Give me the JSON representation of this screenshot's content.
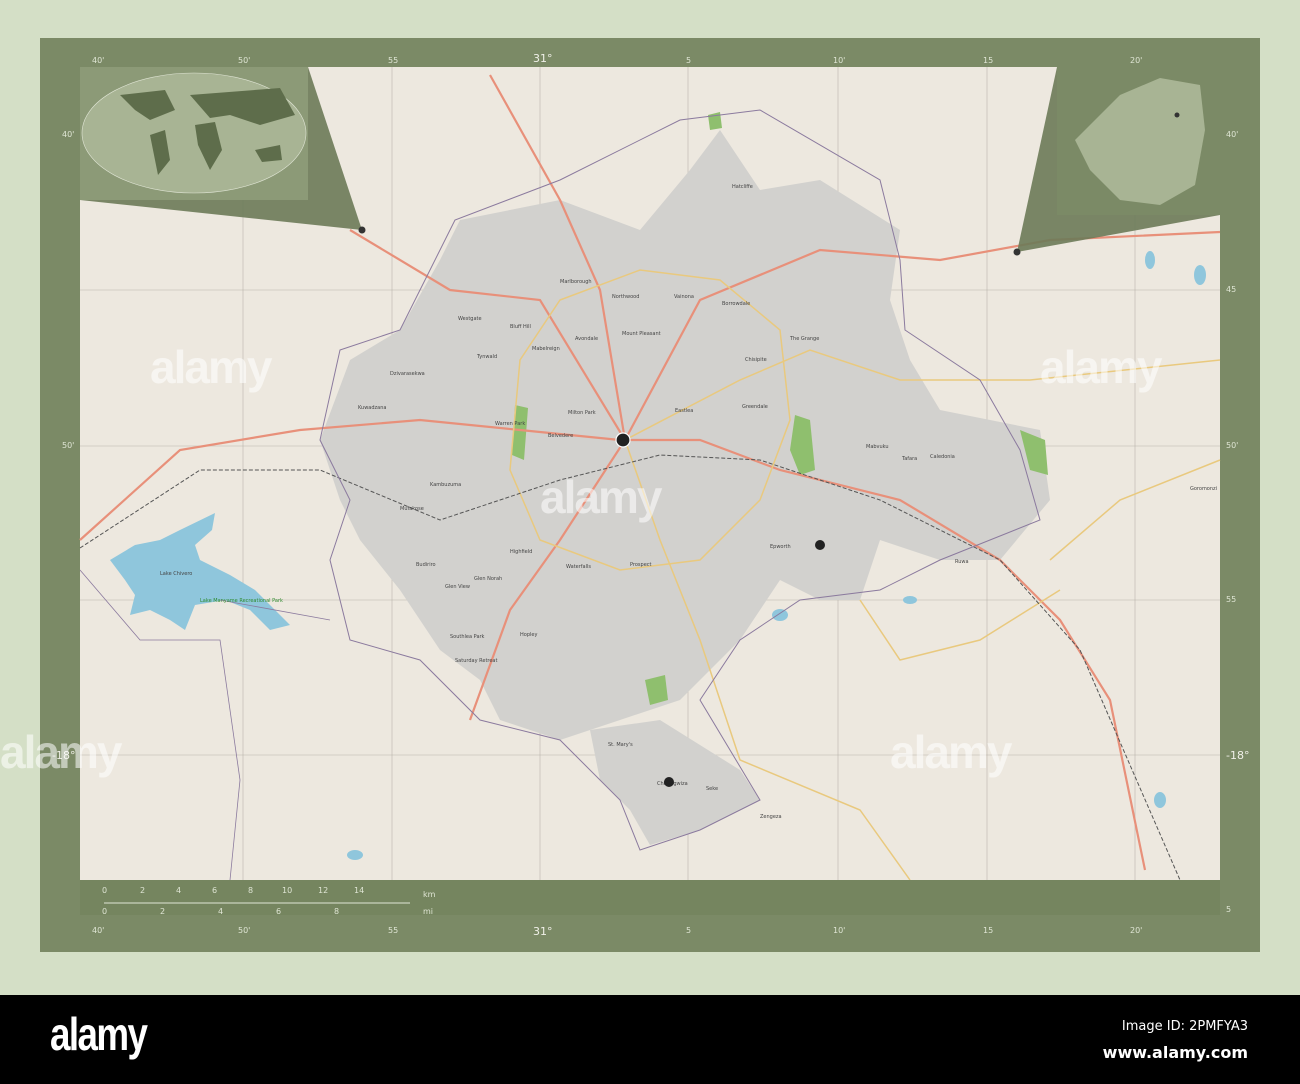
{
  "map": {
    "grid_top": [
      "40'",
      "50'",
      "55",
      "31°",
      "5",
      "10'",
      "15",
      "20'"
    ],
    "grid_side": [
      "40'",
      "45",
      "50'",
      "55",
      "-18°",
      "5"
    ],
    "places": [
      "Marlborough",
      "Northwood",
      "Vainona",
      "Borrowdale",
      "Mount Pleasant",
      "Avondale",
      "Mabelreign",
      "Bluff Hill",
      "Westgate",
      "Tynwald",
      "Dzivarasekwa",
      "Kuwadzana",
      "Warren Park",
      "Milton Park",
      "Belvedere",
      "Eastlea",
      "Greendale",
      "Chisipite",
      "The Grange",
      "Hatcliffe",
      "Mabvuku",
      "Tafara",
      "Caledonia",
      "Ruwa",
      "Epworth",
      "Highfield",
      "Glen View",
      "Budiriro",
      "Glen Norah",
      "Waterfalls",
      "Prospect",
      "Hopley",
      "Southlea Park",
      "Saturday Retreat",
      "St. Mary's",
      "Chitungwiza",
      "Seke",
      "Zengeza",
      "Mufakose",
      "Kambuzuma",
      "Goromonzi",
      "Lake Chivero",
      "Lake Manyame Recreational Park"
    ],
    "colors": {
      "land": "#ede8df",
      "urban": "#cfcfcf",
      "water": "#8fc6dc",
      "major_road": "#e8907a",
      "road": "#e9c97e",
      "park": "#8fbf6e",
      "frame": "#7b8a66"
    }
  },
  "scale": {
    "km_ticks": [
      "0",
      "2",
      "4",
      "6",
      "8",
      "10",
      "12",
      "14"
    ],
    "mi_ticks": [
      "0",
      "2",
      "4",
      "6",
      "8"
    ],
    "km_label": "km",
    "mi_label": "mi"
  },
  "watermark": "alamy",
  "banner": {
    "logo": "alamy",
    "image_id": "Image ID: 2PMFYA3",
    "site": "www.alamy.com"
  }
}
